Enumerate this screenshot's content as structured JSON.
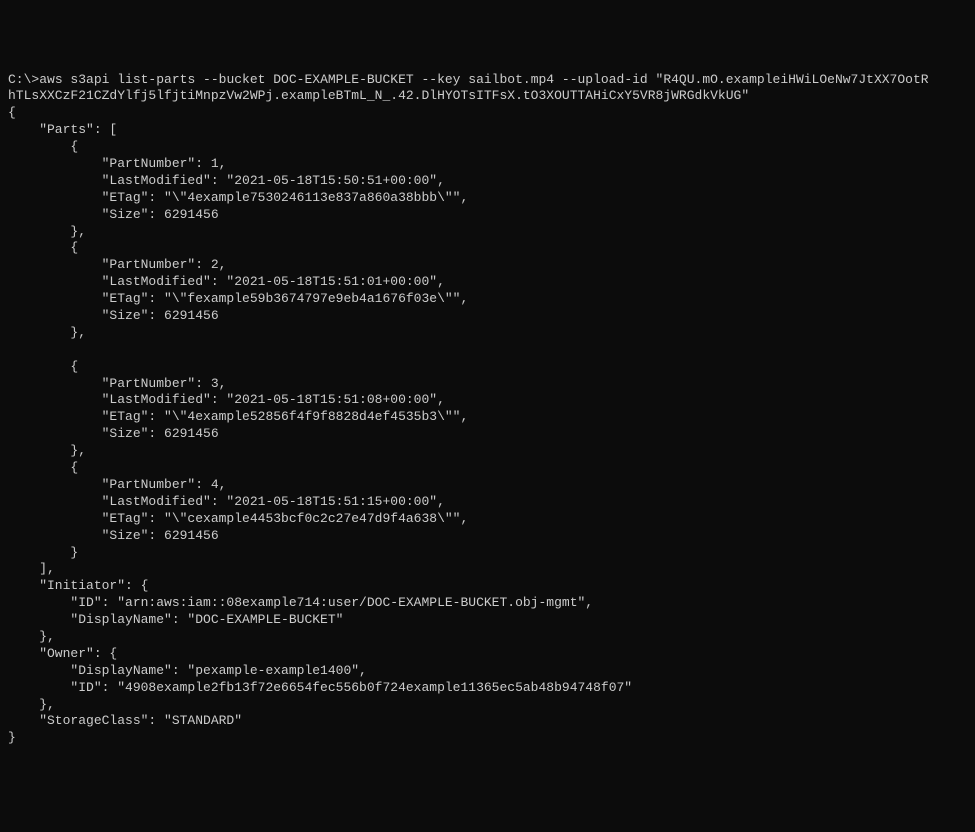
{
  "command": {
    "prompt": "C:\\>",
    "line1": "aws s3api list-parts --bucket DOC-EXAMPLE-BUCKET --key sailbot.mp4 --upload-id \"R4QU.mO.exampleiHWiLOeNw7JtXX7OotR",
    "line2": "hTLsXXCzF21CZdYlfj5lfjtiMnpzVw2WPj.exampleBTmL_N_.42.DlHYOTsITFsX.tO3XOUTTAHiCxY5VR8jWRGdkVkUG\""
  },
  "output": {
    "open_brace": "{",
    "parts_key": "    \"Parts\": [",
    "parts": [
      {
        "open": "        {",
        "partNumber": "            \"PartNumber\": 1,",
        "lastModified": "            \"LastModified\": \"2021-05-18T15:50:51+00:00\",",
        "etag": "            \"ETag\": \"\\\"4example7530246113e837a860a38bbb\\\"\",",
        "size": "            \"Size\": 6291456",
        "close": "        },"
      },
      {
        "open": "        {",
        "partNumber": "            \"PartNumber\": 2,",
        "lastModified": "            \"LastModified\": \"2021-05-18T15:51:01+00:00\",",
        "etag": "            \"ETag\": \"\\\"fexample59b3674797e9eb4a1676f03e\\\"\",",
        "size": "            \"Size\": 6291456",
        "close": "        },"
      },
      {
        "open": "        {",
        "partNumber": "            \"PartNumber\": 3,",
        "lastModified": "            \"LastModified\": \"2021-05-18T15:51:08+00:00\",",
        "etag": "            \"ETag\": \"\\\"4example52856f4f9f8828d4ef4535b3\\\"\",",
        "size": "            \"Size\": 6291456",
        "close": "        },"
      },
      {
        "open": "        {",
        "partNumber": "            \"PartNumber\": 4,",
        "lastModified": "            \"LastModified\": \"2021-05-18T15:51:15+00:00\",",
        "etag": "            \"ETag\": \"\\\"cexample4453bcf0c2c27e47d9f4a638\\\"\",",
        "size": "            \"Size\": 6291456",
        "close": "        }"
      }
    ],
    "parts_close": "    ],",
    "initiator": {
      "open": "    \"Initiator\": {",
      "id": "        \"ID\": \"arn:aws:iam::08example714:user/DOC-EXAMPLE-BUCKET.obj-mgmt\",",
      "displayName": "        \"DisplayName\": \"DOC-EXAMPLE-BUCKET\"",
      "close": "    },"
    },
    "owner": {
      "open": "    \"Owner\": {",
      "displayName": "        \"DisplayName\": \"pexample-example1400\",",
      "id": "        \"ID\": \"4908example2fb13f72e6654fec556b0f724example11365ec5ab48b94748f07\"",
      "close": "    },"
    },
    "storageClass": "    \"StorageClass\": \"STANDARD\"",
    "close_brace": "}"
  }
}
